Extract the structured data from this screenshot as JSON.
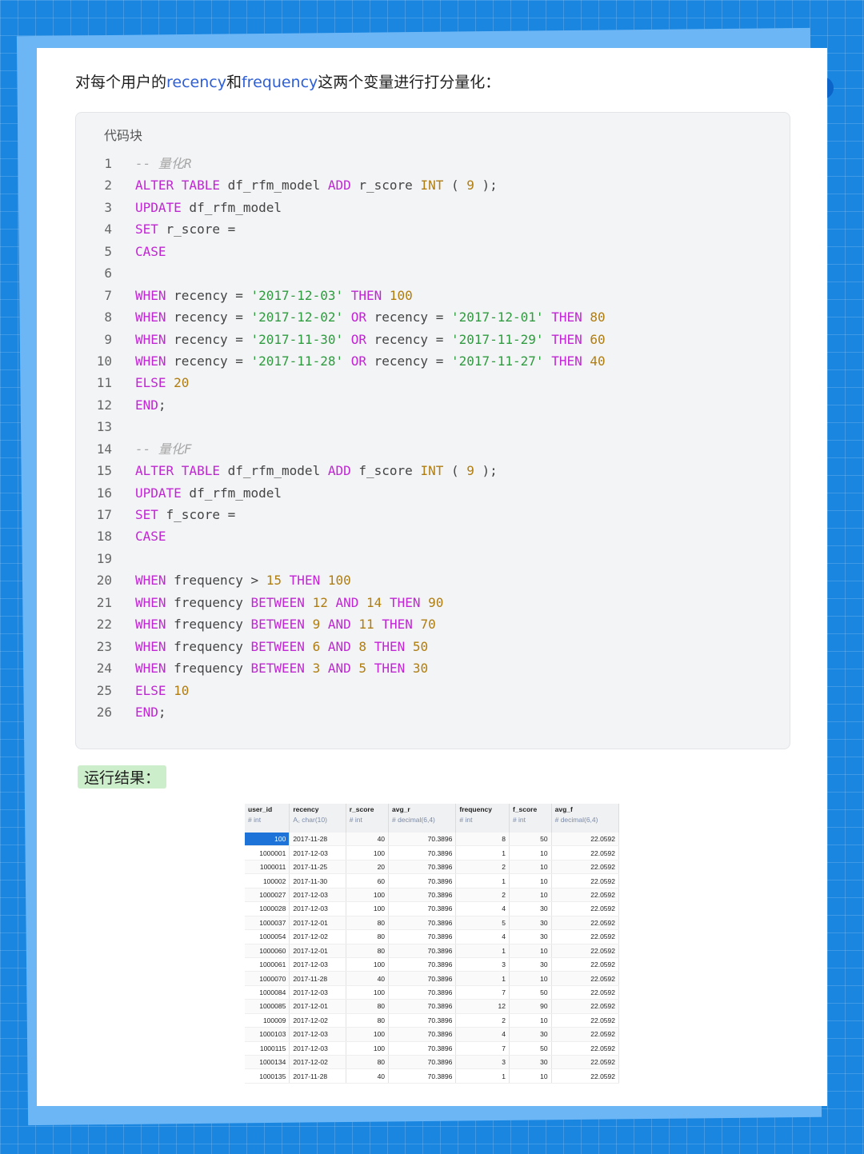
{
  "intro": {
    "prefix": "对每个用户的",
    "term1": "recency",
    "middle": "和",
    "term2": "frequency",
    "suffix": "这两个变量进行打分量化："
  },
  "code_block": {
    "title": "代码块",
    "lines": [
      [
        {
          "t": "cmt",
          "v": "-- 量化R"
        }
      ],
      [
        {
          "t": "kw",
          "v": "ALTER TABLE"
        },
        {
          "t": "op",
          "v": " df_rfm_model "
        },
        {
          "t": "kw",
          "v": "ADD"
        },
        {
          "t": "op",
          "v": " r_score "
        },
        {
          "t": "num",
          "v": "INT"
        },
        {
          "t": "op",
          "v": " ( "
        },
        {
          "t": "num",
          "v": "9"
        },
        {
          "t": "op",
          "v": " );"
        }
      ],
      [
        {
          "t": "kw",
          "v": "UPDATE"
        },
        {
          "t": "op",
          "v": " df_rfm_model"
        }
      ],
      [
        {
          "t": "kw",
          "v": "SET"
        },
        {
          "t": "op",
          "v": " r_score ="
        }
      ],
      [
        {
          "t": "kw",
          "v": "CASE"
        }
      ],
      [],
      [
        {
          "t": "kw",
          "v": "WHEN"
        },
        {
          "t": "op",
          "v": " recency = "
        },
        {
          "t": "str",
          "v": "'2017-12-03'"
        },
        {
          "t": "op",
          "v": " "
        },
        {
          "t": "kw",
          "v": "THEN"
        },
        {
          "t": "op",
          "v": " "
        },
        {
          "t": "num",
          "v": "100"
        }
      ],
      [
        {
          "t": "kw",
          "v": "WHEN"
        },
        {
          "t": "op",
          "v": " recency = "
        },
        {
          "t": "str",
          "v": "'2017-12-02'"
        },
        {
          "t": "op",
          "v": " "
        },
        {
          "t": "kw",
          "v": "OR"
        },
        {
          "t": "op",
          "v": " recency = "
        },
        {
          "t": "str",
          "v": "'2017-12-01'"
        },
        {
          "t": "op",
          "v": " "
        },
        {
          "t": "kw",
          "v": "THEN"
        },
        {
          "t": "op",
          "v": " "
        },
        {
          "t": "num",
          "v": "80"
        }
      ],
      [
        {
          "t": "kw",
          "v": "WHEN"
        },
        {
          "t": "op",
          "v": " recency = "
        },
        {
          "t": "str",
          "v": "'2017-11-30'"
        },
        {
          "t": "op",
          "v": " "
        },
        {
          "t": "kw",
          "v": "OR"
        },
        {
          "t": "op",
          "v": " recency = "
        },
        {
          "t": "str",
          "v": "'2017-11-29'"
        },
        {
          "t": "op",
          "v": " "
        },
        {
          "t": "kw",
          "v": "THEN"
        },
        {
          "t": "op",
          "v": " "
        },
        {
          "t": "num",
          "v": "60"
        }
      ],
      [
        {
          "t": "kw",
          "v": "WHEN"
        },
        {
          "t": "op",
          "v": " recency = "
        },
        {
          "t": "str",
          "v": "'2017-11-28'"
        },
        {
          "t": "op",
          "v": " "
        },
        {
          "t": "kw",
          "v": "OR"
        },
        {
          "t": "op",
          "v": " recency = "
        },
        {
          "t": "str",
          "v": "'2017-11-27'"
        },
        {
          "t": "op",
          "v": " "
        },
        {
          "t": "kw",
          "v": "THEN"
        },
        {
          "t": "op",
          "v": " "
        },
        {
          "t": "num",
          "v": "40"
        }
      ],
      [
        {
          "t": "kw",
          "v": "ELSE"
        },
        {
          "t": "op",
          "v": " "
        },
        {
          "t": "num",
          "v": "20"
        }
      ],
      [
        {
          "t": "kw",
          "v": "END"
        },
        {
          "t": "op",
          "v": ";"
        }
      ],
      [],
      [
        {
          "t": "cmt",
          "v": "-- 量化F"
        }
      ],
      [
        {
          "t": "kw",
          "v": "ALTER TABLE"
        },
        {
          "t": "op",
          "v": " df_rfm_model "
        },
        {
          "t": "kw",
          "v": "ADD"
        },
        {
          "t": "op",
          "v": " f_score "
        },
        {
          "t": "num",
          "v": "INT"
        },
        {
          "t": "op",
          "v": " ( "
        },
        {
          "t": "num",
          "v": "9"
        },
        {
          "t": "op",
          "v": " );"
        }
      ],
      [
        {
          "t": "kw",
          "v": "UPDATE"
        },
        {
          "t": "op",
          "v": " df_rfm_model"
        }
      ],
      [
        {
          "t": "kw",
          "v": "SET"
        },
        {
          "t": "op",
          "v": " f_score ="
        }
      ],
      [
        {
          "t": "kw",
          "v": "CASE"
        }
      ],
      [],
      [
        {
          "t": "kw",
          "v": "WHEN"
        },
        {
          "t": "op",
          "v": " frequency > "
        },
        {
          "t": "num",
          "v": "15"
        },
        {
          "t": "op",
          "v": " "
        },
        {
          "t": "kw",
          "v": "THEN"
        },
        {
          "t": "op",
          "v": " "
        },
        {
          "t": "num",
          "v": "100"
        }
      ],
      [
        {
          "t": "kw",
          "v": "WHEN"
        },
        {
          "t": "op",
          "v": " frequency "
        },
        {
          "t": "kw",
          "v": "BETWEEN"
        },
        {
          "t": "op",
          "v": " "
        },
        {
          "t": "num",
          "v": "12"
        },
        {
          "t": "op",
          "v": " "
        },
        {
          "t": "kw",
          "v": "AND"
        },
        {
          "t": "op",
          "v": " "
        },
        {
          "t": "num",
          "v": "14"
        },
        {
          "t": "op",
          "v": " "
        },
        {
          "t": "kw",
          "v": "THEN"
        },
        {
          "t": "op",
          "v": " "
        },
        {
          "t": "num",
          "v": "90"
        }
      ],
      [
        {
          "t": "kw",
          "v": "WHEN"
        },
        {
          "t": "op",
          "v": " frequency "
        },
        {
          "t": "kw",
          "v": "BETWEEN"
        },
        {
          "t": "op",
          "v": " "
        },
        {
          "t": "num",
          "v": "9"
        },
        {
          "t": "op",
          "v": " "
        },
        {
          "t": "kw",
          "v": "AND"
        },
        {
          "t": "op",
          "v": " "
        },
        {
          "t": "num",
          "v": "11"
        },
        {
          "t": "op",
          "v": " "
        },
        {
          "t": "kw",
          "v": "THEN"
        },
        {
          "t": "op",
          "v": " "
        },
        {
          "t": "num",
          "v": "70"
        }
      ],
      [
        {
          "t": "kw",
          "v": "WHEN"
        },
        {
          "t": "op",
          "v": " frequency "
        },
        {
          "t": "kw",
          "v": "BETWEEN"
        },
        {
          "t": "op",
          "v": " "
        },
        {
          "t": "num",
          "v": "6"
        },
        {
          "t": "op",
          "v": " "
        },
        {
          "t": "kw",
          "v": "AND"
        },
        {
          "t": "op",
          "v": " "
        },
        {
          "t": "num",
          "v": "8"
        },
        {
          "t": "op",
          "v": " "
        },
        {
          "t": "kw",
          "v": "THEN"
        },
        {
          "t": "op",
          "v": " "
        },
        {
          "t": "num",
          "v": "50"
        }
      ],
      [
        {
          "t": "kw",
          "v": "WHEN"
        },
        {
          "t": "op",
          "v": " frequency "
        },
        {
          "t": "kw",
          "v": "BETWEEN"
        },
        {
          "t": "op",
          "v": " "
        },
        {
          "t": "num",
          "v": "3"
        },
        {
          "t": "op",
          "v": " "
        },
        {
          "t": "kw",
          "v": "AND"
        },
        {
          "t": "op",
          "v": " "
        },
        {
          "t": "num",
          "v": "5"
        },
        {
          "t": "op",
          "v": " "
        },
        {
          "t": "kw",
          "v": "THEN"
        },
        {
          "t": "op",
          "v": " "
        },
        {
          "t": "num",
          "v": "30"
        }
      ],
      [
        {
          "t": "kw",
          "v": "ELSE"
        },
        {
          "t": "op",
          "v": " "
        },
        {
          "t": "num",
          "v": "10"
        }
      ],
      [
        {
          "t": "kw",
          "v": "END"
        },
        {
          "t": "op",
          "v": ";"
        }
      ]
    ]
  },
  "result_label": "运行结果：",
  "result_table": {
    "columns": [
      {
        "key": "user_id",
        "name": "user_id",
        "type": "# int"
      },
      {
        "key": "recency",
        "name": "recency",
        "type": "A꜀ char(10)"
      },
      {
        "key": "r_score",
        "name": "r_score",
        "type": "# int"
      },
      {
        "key": "avg_r",
        "name": "avg_r",
        "type": "# decimal(6,4)"
      },
      {
        "key": "frequency",
        "name": "frequency",
        "type": "# int"
      },
      {
        "key": "f_score",
        "name": "f_score",
        "type": "# int"
      },
      {
        "key": "avg_f",
        "name": "avg_f",
        "type": "# decimal(6,4)"
      }
    ],
    "rows": [
      [
        "100",
        "2017-11-28",
        "40",
        "70.3896",
        "8",
        "50",
        "22.0592"
      ],
      [
        "1000001",
        "2017-12-03",
        "100",
        "70.3896",
        "1",
        "10",
        "22.0592"
      ],
      [
        "1000011",
        "2017-11-25",
        "20",
        "70.3896",
        "2",
        "10",
        "22.0592"
      ],
      [
        "100002",
        "2017-11-30",
        "60",
        "70.3896",
        "1",
        "10",
        "22.0592"
      ],
      [
        "1000027",
        "2017-12-03",
        "100",
        "70.3896",
        "2",
        "10",
        "22.0592"
      ],
      [
        "1000028",
        "2017-12-03",
        "100",
        "70.3896",
        "4",
        "30",
        "22.0592"
      ],
      [
        "1000037",
        "2017-12-01",
        "80",
        "70.3896",
        "5",
        "30",
        "22.0592"
      ],
      [
        "1000054",
        "2017-12-02",
        "80",
        "70.3896",
        "4",
        "30",
        "22.0592"
      ],
      [
        "1000060",
        "2017-12-01",
        "80",
        "70.3896",
        "1",
        "10",
        "22.0592"
      ],
      [
        "1000061",
        "2017-12-03",
        "100",
        "70.3896",
        "3",
        "30",
        "22.0592"
      ],
      [
        "1000070",
        "2017-11-28",
        "40",
        "70.3896",
        "1",
        "10",
        "22.0592"
      ],
      [
        "1000084",
        "2017-12-03",
        "100",
        "70.3896",
        "7",
        "50",
        "22.0592"
      ],
      [
        "1000085",
        "2017-12-01",
        "80",
        "70.3896",
        "12",
        "90",
        "22.0592"
      ],
      [
        "100009",
        "2017-12-02",
        "80",
        "70.3896",
        "2",
        "10",
        "22.0592"
      ],
      [
        "1000103",
        "2017-12-03",
        "100",
        "70.3896",
        "4",
        "30",
        "22.0592"
      ],
      [
        "1000115",
        "2017-12-03",
        "100",
        "70.3896",
        "7",
        "50",
        "22.0592"
      ],
      [
        "1000134",
        "2017-12-02",
        "80",
        "70.3896",
        "3",
        "30",
        "22.0592"
      ],
      [
        "1000135",
        "2017-11-28",
        "40",
        "70.3896",
        "1",
        "10",
        "22.0592"
      ]
    ]
  }
}
